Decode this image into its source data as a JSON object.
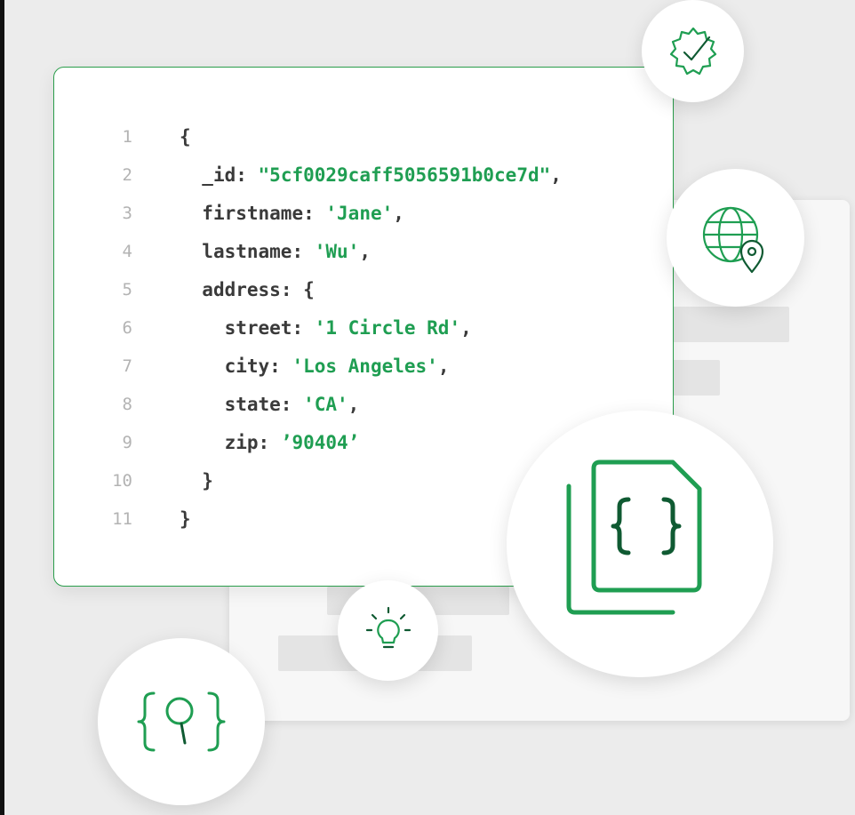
{
  "code": {
    "lines": [
      {
        "n": "1",
        "indent": "",
        "key": "",
        "sep": "",
        "value": "",
        "tail": "{"
      },
      {
        "n": "2",
        "indent": "  ",
        "key": "_id",
        "sep": ": ",
        "value": "\"5cf0029caff5056591b0ce7d\"",
        "tail": ","
      },
      {
        "n": "3",
        "indent": "  ",
        "key": "firstname",
        "sep": ": ",
        "value": "'Jane'",
        "tail": ","
      },
      {
        "n": "4",
        "indent": "  ",
        "key": "lastname",
        "sep": ": ",
        "value": "'Wu'",
        "tail": ","
      },
      {
        "n": "5",
        "indent": "  ",
        "key": "address",
        "sep": ": ",
        "value": "",
        "tail": "{"
      },
      {
        "n": "6",
        "indent": "    ",
        "key": "street",
        "sep": ": ",
        "value": "'1 Circle Rd'",
        "tail": ","
      },
      {
        "n": "7",
        "indent": "    ",
        "key": "city",
        "sep": ": ",
        "value": "'Los Angeles'",
        "tail": ","
      },
      {
        "n": "8",
        "indent": "    ",
        "key": "state",
        "sep": ": ",
        "value": "'CA'",
        "tail": ","
      },
      {
        "n": "9",
        "indent": "    ",
        "key": "zip",
        "sep": ": ",
        "value": "’90404’",
        "tail": ""
      },
      {
        "n": "10",
        "indent": "  ",
        "key": "",
        "sep": "",
        "value": "",
        "tail": "}"
      },
      {
        "n": "11",
        "indent": "",
        "key": "",
        "sep": "",
        "value": "",
        "tail": "}"
      }
    ]
  },
  "icons": {
    "verified": "verified-badge-icon",
    "globe": "globe-location-icon",
    "document": "json-document-icon",
    "bulb": "lightbulb-icon",
    "search": "json-search-icon"
  },
  "colors": {
    "accent": "#2a9d4b",
    "accent_dark": "#0f5a32",
    "string": "#1f9e52",
    "code_text": "#3a3a3a",
    "line_number": "#b3b3b3"
  }
}
